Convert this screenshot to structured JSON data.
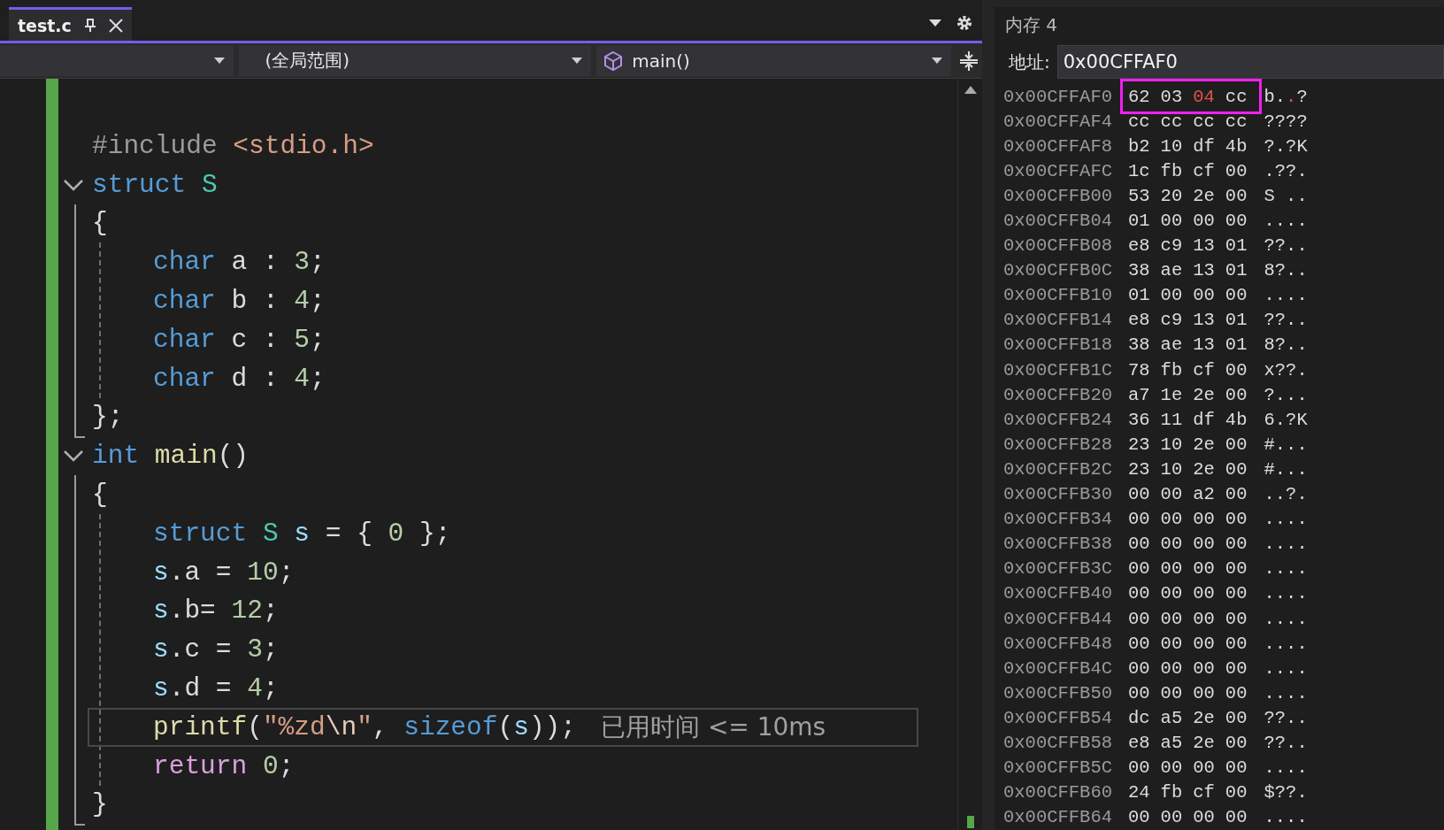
{
  "tabs": [
    {
      "label": "test.c",
      "selected": true
    }
  ],
  "nav": {
    "scope": {
      "label": "(全局范围)"
    },
    "member": {
      "label": "main()"
    }
  },
  "code": [
    {
      "kind": "line",
      "tokens": [
        {
          "t": "#include ",
          "kind": "preproc"
        },
        {
          "t": "<stdio.h>",
          "kind": "include_path"
        }
      ]
    },
    {
      "kind": "block",
      "expanded": true,
      "header": [
        {
          "t": "struct ",
          "kind": "keyword"
        },
        {
          "t": "S",
          "kind": "type"
        }
      ],
      "open": [
        {
          "t": "{",
          "kind": "plain"
        }
      ],
      "close": [
        {
          "t": "};",
          "kind": "plain"
        }
      ],
      "body": [
        {
          "current": false,
          "tokens": [
            {
              "t": "char ",
              "kind": "keyword"
            },
            {
              "t": "a : ",
              "kind": "plain"
            },
            {
              "t": "3",
              "kind": "number"
            },
            {
              "t": ";",
              "kind": "plain"
            }
          ]
        },
        {
          "current": false,
          "tokens": [
            {
              "t": "char ",
              "kind": "keyword"
            },
            {
              "t": "b : ",
              "kind": "plain"
            },
            {
              "t": "4",
              "kind": "number"
            },
            {
              "t": ";",
              "kind": "plain"
            }
          ]
        },
        {
          "current": false,
          "tokens": [
            {
              "t": "char ",
              "kind": "keyword"
            },
            {
              "t": "c : ",
              "kind": "plain"
            },
            {
              "t": "5",
              "kind": "number"
            },
            {
              "t": ";",
              "kind": "plain"
            }
          ]
        },
        {
          "current": false,
          "tokens": [
            {
              "t": "char ",
              "kind": "keyword"
            },
            {
              "t": "d : ",
              "kind": "plain"
            },
            {
              "t": "4",
              "kind": "number"
            },
            {
              "t": ";",
              "kind": "plain"
            }
          ]
        }
      ]
    },
    {
      "kind": "block",
      "expanded": true,
      "header": [
        {
          "t": "int ",
          "kind": "keyword"
        },
        {
          "t": "main",
          "kind": "function"
        },
        {
          "t": "()",
          "kind": "plain"
        }
      ],
      "open": [
        {
          "t": "{",
          "kind": "plain"
        }
      ],
      "close": [
        {
          "t": "}",
          "kind": "plain"
        }
      ],
      "body": [
        {
          "current": false,
          "tokens": [
            {
              "t": "struct ",
              "kind": "keyword"
            },
            {
              "t": "S ",
              "kind": "type"
            },
            {
              "t": "s ",
              "kind": "variable"
            },
            {
              "t": "= { ",
              "kind": "plain"
            },
            {
              "t": "0",
              "kind": "number"
            },
            {
              "t": " };",
              "kind": "plain"
            }
          ]
        },
        {
          "current": false,
          "tokens": [
            {
              "t": "s",
              "kind": "variable"
            },
            {
              "t": ".a = ",
              "kind": "plain"
            },
            {
              "t": "10",
              "kind": "number"
            },
            {
              "t": ";",
              "kind": "plain"
            }
          ]
        },
        {
          "current": false,
          "tokens": [
            {
              "t": "s",
              "kind": "variable"
            },
            {
              "t": ".b= ",
              "kind": "plain"
            },
            {
              "t": "12",
              "kind": "number"
            },
            {
              "t": ";",
              "kind": "plain"
            }
          ]
        },
        {
          "current": false,
          "tokens": [
            {
              "t": "s",
              "kind": "variable"
            },
            {
              "t": ".c = ",
              "kind": "plain"
            },
            {
              "t": "3",
              "kind": "number"
            },
            {
              "t": ";",
              "kind": "plain"
            }
          ]
        },
        {
          "current": false,
          "tokens": [
            {
              "t": "s",
              "kind": "variable"
            },
            {
              "t": ".d = ",
              "kind": "plain"
            },
            {
              "t": "4",
              "kind": "number"
            },
            {
              "t": ";",
              "kind": "plain"
            }
          ]
        },
        {
          "current": true,
          "hint": "已用时间 <= 10ms",
          "tokens": [
            {
              "t": "printf",
              "kind": "function"
            },
            {
              "t": "(",
              "kind": "plain"
            },
            {
              "t": "\"%zd",
              "kind": "string"
            },
            {
              "t": "\\n",
              "kind": "escape"
            },
            {
              "t": "\"",
              "kind": "string"
            },
            {
              "t": ", ",
              "kind": "plain"
            },
            {
              "t": "sizeof",
              "kind": "keyword"
            },
            {
              "t": "(",
              "kind": "plain"
            },
            {
              "t": "s",
              "kind": "variable"
            },
            {
              "t": "));",
              "kind": "plain"
            }
          ]
        },
        {
          "current": false,
          "tokens": [
            {
              "t": "return ",
              "kind": "control"
            },
            {
              "t": "0",
              "kind": "number"
            },
            {
              "t": ";",
              "kind": "plain"
            }
          ]
        }
      ]
    }
  ],
  "memory": {
    "title": "内存 4",
    "address_label": "地址:",
    "address": "0x00CFFAF0",
    "rows": [
      {
        "address": "0x00CFFAF0",
        "highlighted": true,
        "bytes": [
          {
            "v": "62",
            "changed": false
          },
          {
            "v": "03",
            "changed": false
          },
          {
            "v": "04",
            "changed": true
          },
          {
            "v": "cc",
            "changed": false
          }
        ],
        "ascii": "b..?"
      },
      {
        "address": "0x00CFFAF4",
        "highlighted": false,
        "bytes": [
          {
            "v": "cc",
            "changed": false
          },
          {
            "v": "cc",
            "changed": false
          },
          {
            "v": "cc",
            "changed": false
          },
          {
            "v": "cc",
            "changed": false
          }
        ],
        "ascii": "????"
      },
      {
        "address": "0x00CFFAF8",
        "highlighted": false,
        "bytes": [
          {
            "v": "b2",
            "changed": false
          },
          {
            "v": "10",
            "changed": false
          },
          {
            "v": "df",
            "changed": false
          },
          {
            "v": "4b",
            "changed": false
          }
        ],
        "ascii": "?.?K"
      },
      {
        "address": "0x00CFFAFC",
        "highlighted": false,
        "bytes": [
          {
            "v": "1c",
            "changed": false
          },
          {
            "v": "fb",
            "changed": false
          },
          {
            "v": "cf",
            "changed": false
          },
          {
            "v": "00",
            "changed": false
          }
        ],
        "ascii": ".??."
      },
      {
        "address": "0x00CFFB00",
        "highlighted": false,
        "bytes": [
          {
            "v": "53",
            "changed": false
          },
          {
            "v": "20",
            "changed": false
          },
          {
            "v": "2e",
            "changed": false
          },
          {
            "v": "00",
            "changed": false
          }
        ],
        "ascii": "S .."
      },
      {
        "address": "0x00CFFB04",
        "highlighted": false,
        "bytes": [
          {
            "v": "01",
            "changed": false
          },
          {
            "v": "00",
            "changed": false
          },
          {
            "v": "00",
            "changed": false
          },
          {
            "v": "00",
            "changed": false
          }
        ],
        "ascii": "...."
      },
      {
        "address": "0x00CFFB08",
        "highlighted": false,
        "bytes": [
          {
            "v": "e8",
            "changed": false
          },
          {
            "v": "c9",
            "changed": false
          },
          {
            "v": "13",
            "changed": false
          },
          {
            "v": "01",
            "changed": false
          }
        ],
        "ascii": "??.."
      },
      {
        "address": "0x00CFFB0C",
        "highlighted": false,
        "bytes": [
          {
            "v": "38",
            "changed": false
          },
          {
            "v": "ae",
            "changed": false
          },
          {
            "v": "13",
            "changed": false
          },
          {
            "v": "01",
            "changed": false
          }
        ],
        "ascii": "8?.."
      },
      {
        "address": "0x00CFFB10",
        "highlighted": false,
        "bytes": [
          {
            "v": "01",
            "changed": false
          },
          {
            "v": "00",
            "changed": false
          },
          {
            "v": "00",
            "changed": false
          },
          {
            "v": "00",
            "changed": false
          }
        ],
        "ascii": "...."
      },
      {
        "address": "0x00CFFB14",
        "highlighted": false,
        "bytes": [
          {
            "v": "e8",
            "changed": false
          },
          {
            "v": "c9",
            "changed": false
          },
          {
            "v": "13",
            "changed": false
          },
          {
            "v": "01",
            "changed": false
          }
        ],
        "ascii": "??.."
      },
      {
        "address": "0x00CFFB18",
        "highlighted": false,
        "bytes": [
          {
            "v": "38",
            "changed": false
          },
          {
            "v": "ae",
            "changed": false
          },
          {
            "v": "13",
            "changed": false
          },
          {
            "v": "01",
            "changed": false
          }
        ],
        "ascii": "8?.."
      },
      {
        "address": "0x00CFFB1C",
        "highlighted": false,
        "bytes": [
          {
            "v": "78",
            "changed": false
          },
          {
            "v": "fb",
            "changed": false
          },
          {
            "v": "cf",
            "changed": false
          },
          {
            "v": "00",
            "changed": false
          }
        ],
        "ascii": "x??."
      },
      {
        "address": "0x00CFFB20",
        "highlighted": false,
        "bytes": [
          {
            "v": "a7",
            "changed": false
          },
          {
            "v": "1e",
            "changed": false
          },
          {
            "v": "2e",
            "changed": false
          },
          {
            "v": "00",
            "changed": false
          }
        ],
        "ascii": "?..."
      },
      {
        "address": "0x00CFFB24",
        "highlighted": false,
        "bytes": [
          {
            "v": "36",
            "changed": false
          },
          {
            "v": "11",
            "changed": false
          },
          {
            "v": "df",
            "changed": false
          },
          {
            "v": "4b",
            "changed": false
          }
        ],
        "ascii": "6.?K"
      },
      {
        "address": "0x00CFFB28",
        "highlighted": false,
        "bytes": [
          {
            "v": "23",
            "changed": false
          },
          {
            "v": "10",
            "changed": false
          },
          {
            "v": "2e",
            "changed": false
          },
          {
            "v": "00",
            "changed": false
          }
        ],
        "ascii": "#..."
      },
      {
        "address": "0x00CFFB2C",
        "highlighted": false,
        "bytes": [
          {
            "v": "23",
            "changed": false
          },
          {
            "v": "10",
            "changed": false
          },
          {
            "v": "2e",
            "changed": false
          },
          {
            "v": "00",
            "changed": false
          }
        ],
        "ascii": "#..."
      },
      {
        "address": "0x00CFFB30",
        "highlighted": false,
        "bytes": [
          {
            "v": "00",
            "changed": false
          },
          {
            "v": "00",
            "changed": false
          },
          {
            "v": "a2",
            "changed": false
          },
          {
            "v": "00",
            "changed": false
          }
        ],
        "ascii": "..?."
      },
      {
        "address": "0x00CFFB34",
        "highlighted": false,
        "bytes": [
          {
            "v": "00",
            "changed": false
          },
          {
            "v": "00",
            "changed": false
          },
          {
            "v": "00",
            "changed": false
          },
          {
            "v": "00",
            "changed": false
          }
        ],
        "ascii": "...."
      },
      {
        "address": "0x00CFFB38",
        "highlighted": false,
        "bytes": [
          {
            "v": "00",
            "changed": false
          },
          {
            "v": "00",
            "changed": false
          },
          {
            "v": "00",
            "changed": false
          },
          {
            "v": "00",
            "changed": false
          }
        ],
        "ascii": "...."
      },
      {
        "address": "0x00CFFB3C",
        "highlighted": false,
        "bytes": [
          {
            "v": "00",
            "changed": false
          },
          {
            "v": "00",
            "changed": false
          },
          {
            "v": "00",
            "changed": false
          },
          {
            "v": "00",
            "changed": false
          }
        ],
        "ascii": "...."
      },
      {
        "address": "0x00CFFB40",
        "highlighted": false,
        "bytes": [
          {
            "v": "00",
            "changed": false
          },
          {
            "v": "00",
            "changed": false
          },
          {
            "v": "00",
            "changed": false
          },
          {
            "v": "00",
            "changed": false
          }
        ],
        "ascii": "...."
      },
      {
        "address": "0x00CFFB44",
        "highlighted": false,
        "bytes": [
          {
            "v": "00",
            "changed": false
          },
          {
            "v": "00",
            "changed": false
          },
          {
            "v": "00",
            "changed": false
          },
          {
            "v": "00",
            "changed": false
          }
        ],
        "ascii": "...."
      },
      {
        "address": "0x00CFFB48",
        "highlighted": false,
        "bytes": [
          {
            "v": "00",
            "changed": false
          },
          {
            "v": "00",
            "changed": false
          },
          {
            "v": "00",
            "changed": false
          },
          {
            "v": "00",
            "changed": false
          }
        ],
        "ascii": "...."
      },
      {
        "address": "0x00CFFB4C",
        "highlighted": false,
        "bytes": [
          {
            "v": "00",
            "changed": false
          },
          {
            "v": "00",
            "changed": false
          },
          {
            "v": "00",
            "changed": false
          },
          {
            "v": "00",
            "changed": false
          }
        ],
        "ascii": "...."
      },
      {
        "address": "0x00CFFB50",
        "highlighted": false,
        "bytes": [
          {
            "v": "00",
            "changed": false
          },
          {
            "v": "00",
            "changed": false
          },
          {
            "v": "00",
            "changed": false
          },
          {
            "v": "00",
            "changed": false
          }
        ],
        "ascii": "...."
      },
      {
        "address": "0x00CFFB54",
        "highlighted": false,
        "bytes": [
          {
            "v": "dc",
            "changed": false
          },
          {
            "v": "a5",
            "changed": false
          },
          {
            "v": "2e",
            "changed": false
          },
          {
            "v": "00",
            "changed": false
          }
        ],
        "ascii": "??.."
      },
      {
        "address": "0x00CFFB58",
        "highlighted": false,
        "bytes": [
          {
            "v": "e8",
            "changed": false
          },
          {
            "v": "a5",
            "changed": false
          },
          {
            "v": "2e",
            "changed": false
          },
          {
            "v": "00",
            "changed": false
          }
        ],
        "ascii": "??.."
      },
      {
        "address": "0x00CFFB5C",
        "highlighted": false,
        "bytes": [
          {
            "v": "00",
            "changed": false
          },
          {
            "v": "00",
            "changed": false
          },
          {
            "v": "00",
            "changed": false
          },
          {
            "v": "00",
            "changed": false
          }
        ],
        "ascii": "...."
      },
      {
        "address": "0x00CFFB60",
        "highlighted": false,
        "bytes": [
          {
            "v": "24",
            "changed": false
          },
          {
            "v": "fb",
            "changed": false
          },
          {
            "v": "cf",
            "changed": false
          },
          {
            "v": "00",
            "changed": false
          }
        ],
        "ascii": "$??."
      },
      {
        "address": "0x00CFFB64",
        "highlighted": false,
        "bytes": [
          {
            "v": "00",
            "changed": false
          },
          {
            "v": "00",
            "changed": false
          },
          {
            "v": "00",
            "changed": false
          },
          {
            "v": "00",
            "changed": false
          }
        ],
        "ascii": "...."
      }
    ]
  }
}
